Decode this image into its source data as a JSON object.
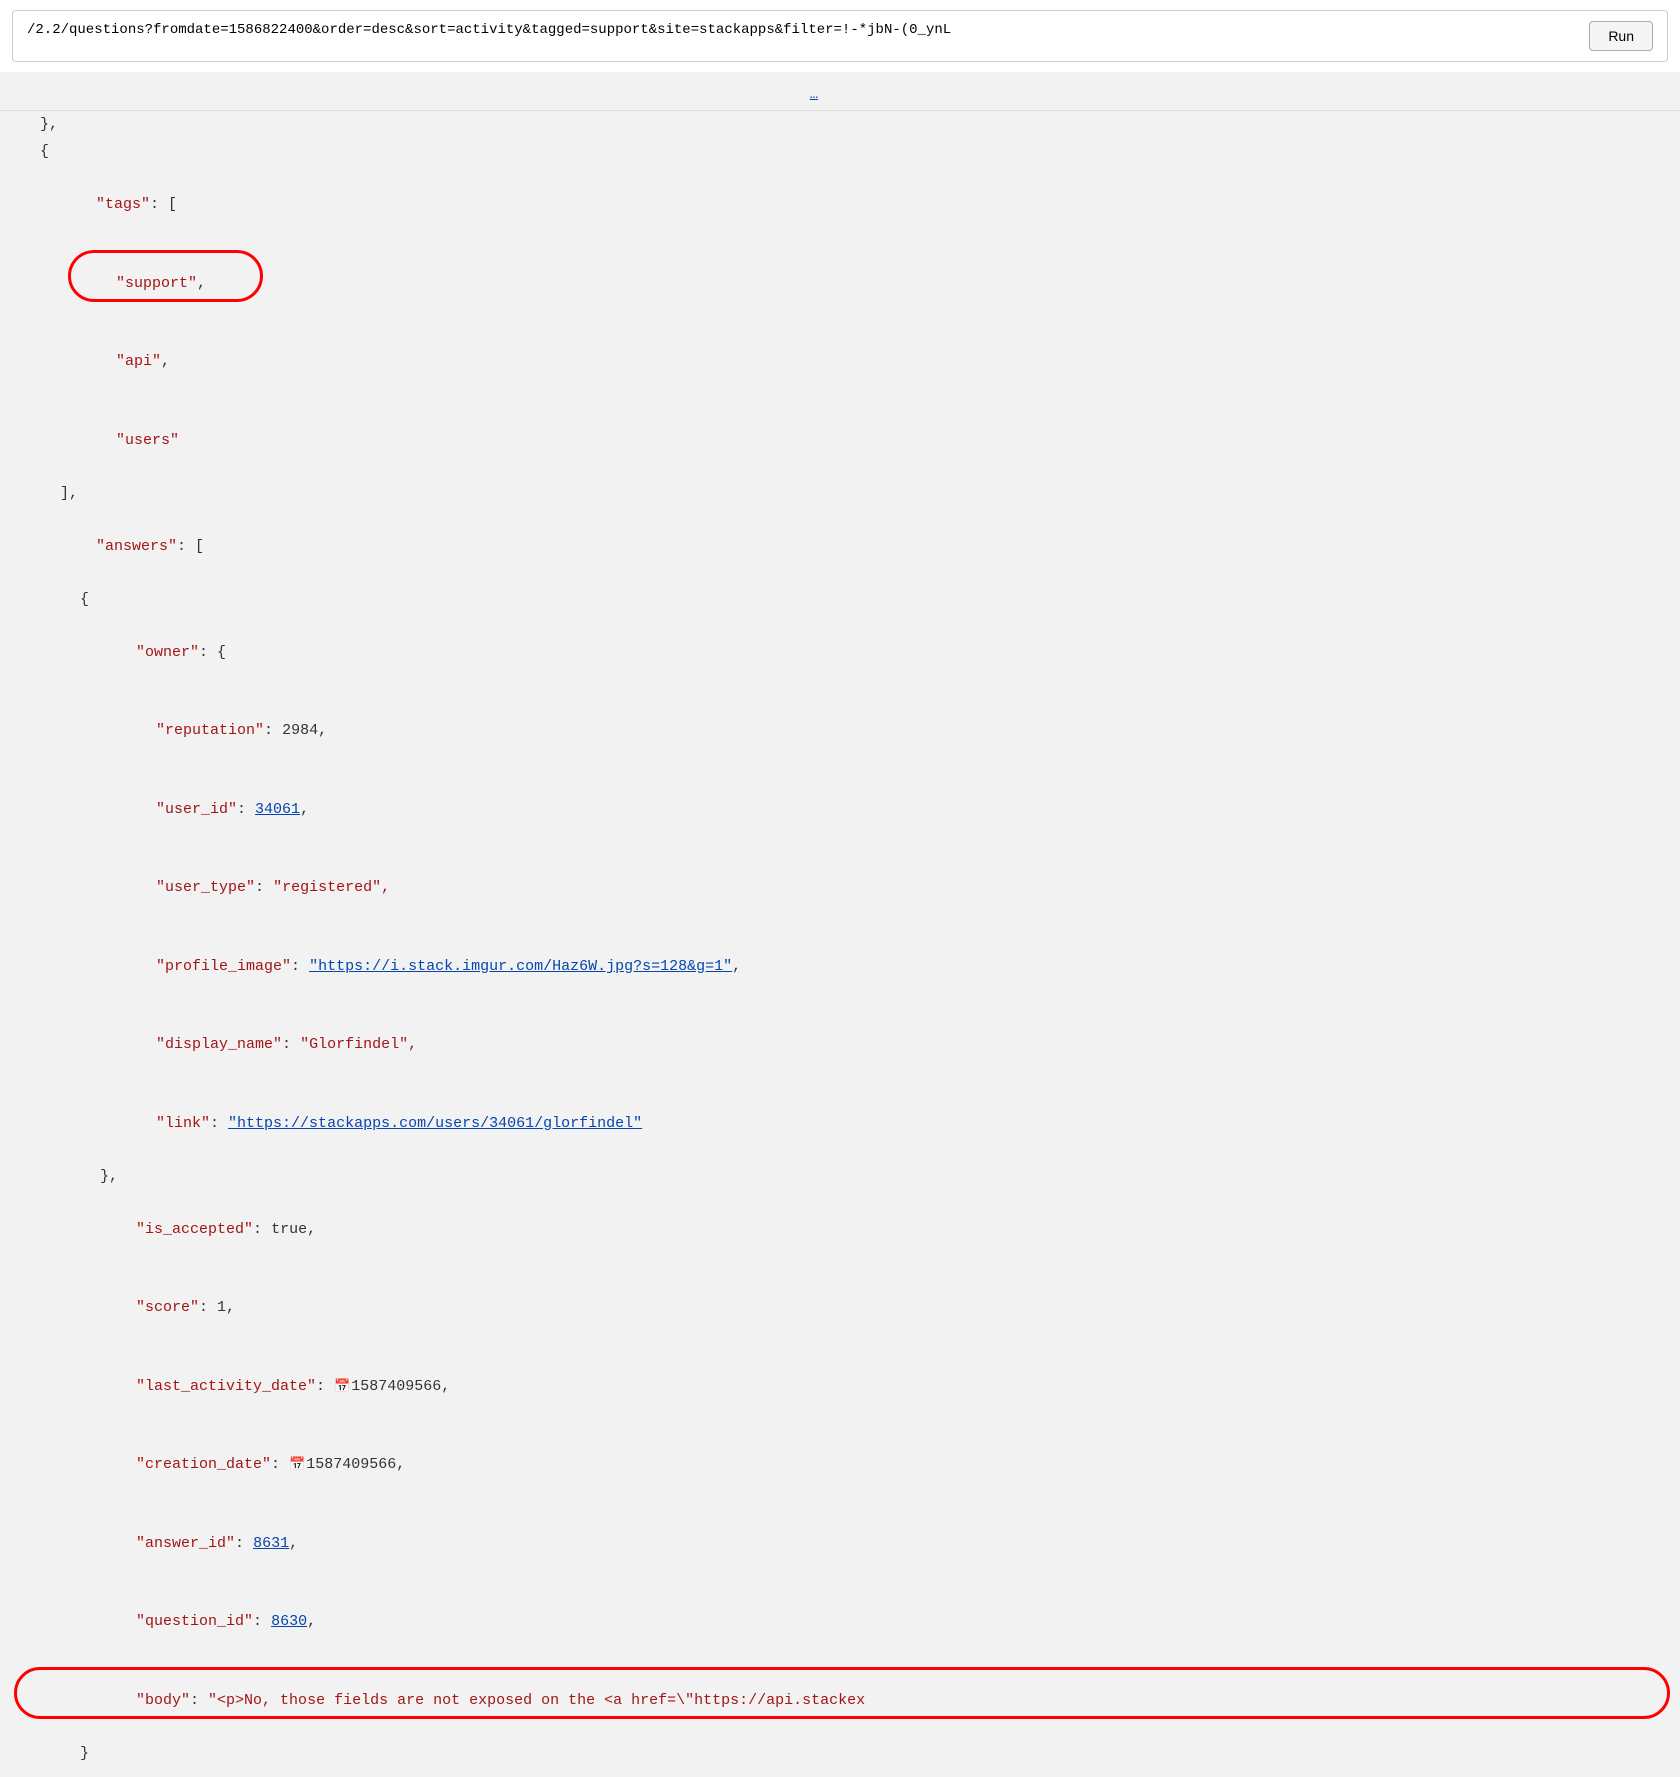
{
  "urlbar": {
    "url": "/2.2/questions?fromdate=1586822400&order=desc&sort=activity&tagged=support&site=stackapps&filter=!-*jbN-(0_ynL",
    "run_label": "Run"
  },
  "json_content": {
    "tags_key": "\"tags\"",
    "tag_support": "\"support\"",
    "tag_api": "\"api\"",
    "tag_users": "\"users\"",
    "answers_key": "\"answers\"",
    "owner_key": "\"owner\"",
    "reputation_key": "\"reputation\"",
    "reputation_val": "2984,",
    "user_id_key": "\"user_id\"",
    "user_id_val": "34061",
    "user_type_key": "\"user_type\"",
    "user_type_val": "\"registered\",",
    "profile_image_key": "\"profile_image\"",
    "profile_image_val": "\"https://i.stack.imgur.com/Haz6W.jpg?s=128&g=1\"",
    "display_name_key": "\"display_name\"",
    "display_name_val": "\"Glorfindel\",",
    "link_key": "\"link\"",
    "link_val": "\"https://stackapps.com/users/34061/glorfindel\"",
    "is_accepted_key": "\"is_accepted\"",
    "is_accepted_val": "true,",
    "score_key": "\"score\"",
    "score_val": "1,",
    "last_activity_key": "\"last_activity_date\"",
    "last_activity_val": "1587409566,",
    "creation_date_key": "\"creation_date\"",
    "creation_date_val": "1587409566,",
    "answer_id_key": "\"answer_id\"",
    "answer_id_val": "8631",
    "question_id_key": "\"question_id\"",
    "question_id_val": "8630",
    "body_key": "\"body\"",
    "body_val": "\"<p>No, those fields are not exposed on the <a href=\\\"https://api.stackex"
  }
}
